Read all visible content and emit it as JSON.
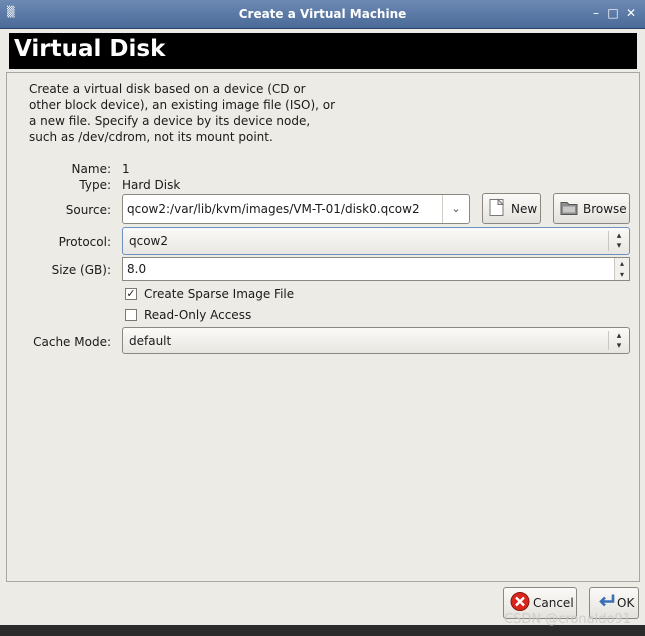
{
  "window": {
    "title": "Create a Virtual Machine",
    "app_icon": "app-menu-icon",
    "controls": [
      "minimize-icon",
      "maximize-icon",
      "close-icon"
    ]
  },
  "header": {
    "title": "Virtual Disk"
  },
  "description": [
    "Create a virtual disk based on a device (CD or",
    "other block device), an existing image file (ISO), or",
    "a new file.  Specify a device by its device node,",
    "such as /dev/cdrom, not its mount point."
  ],
  "fields": {
    "name": {
      "label": "Name:",
      "value": "1"
    },
    "type": {
      "label": "Type:",
      "value": "Hard Disk"
    },
    "source": {
      "label": "Source:",
      "value": "qcow2:/var/lib/kvm/images/VM-T-01/disk0.qcow2"
    },
    "protocol": {
      "label": "Protocol:",
      "value": "qcow2"
    },
    "size": {
      "label": "Size (GB):",
      "value": "8.0"
    },
    "cache_mode": {
      "label": "Cache Mode:",
      "value": "default"
    }
  },
  "buttons": {
    "new": "New",
    "browse": "Browse",
    "cancel": "Cancel",
    "ok": "OK"
  },
  "checkboxes": {
    "sparse": {
      "label": "Create Sparse Image File",
      "checked": true
    },
    "readonly": {
      "label": "Read-Only Access",
      "checked": false
    }
  },
  "watermark": "CSDN @cronaldo91",
  "colors": {
    "titlebar": "#5a79a6",
    "header_bg": "#000000",
    "window_bg": "#edebe6"
  }
}
